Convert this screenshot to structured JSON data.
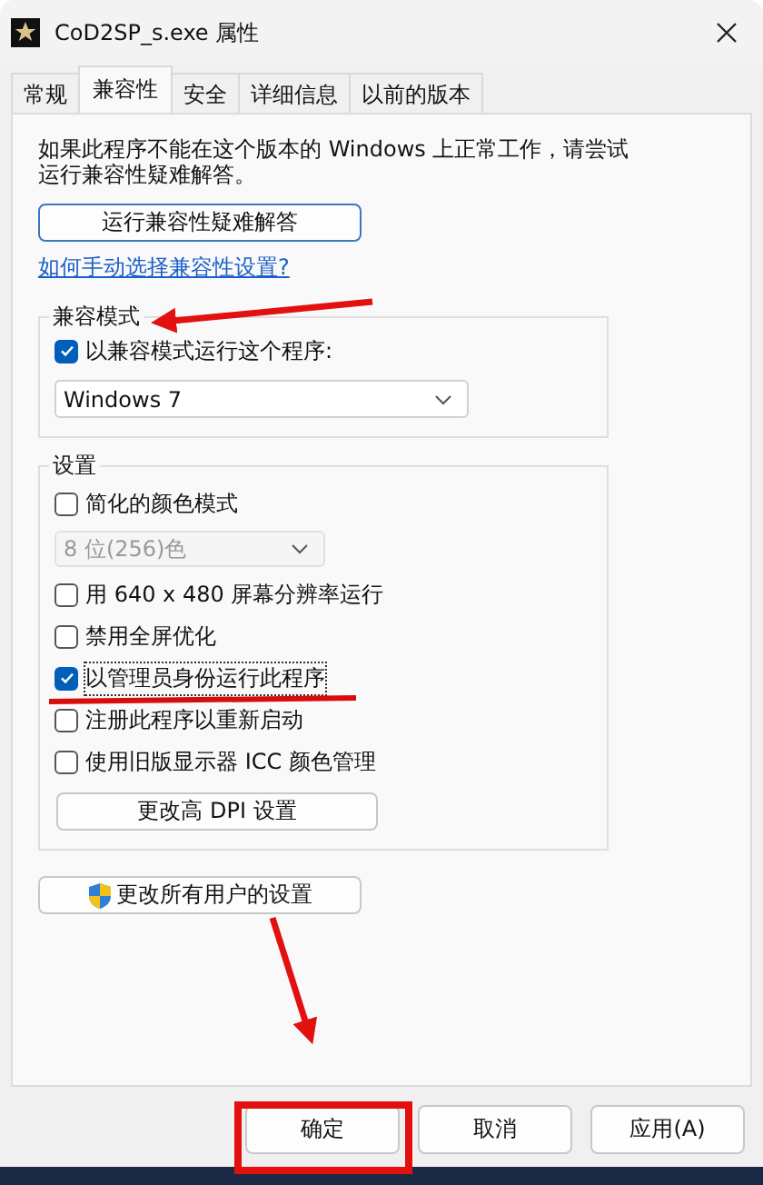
{
  "window": {
    "title": "CoD2SP_s.exe 属性"
  },
  "tabs": [
    {
      "label": "常规",
      "selected": false
    },
    {
      "label": "兼容性",
      "selected": true
    },
    {
      "label": "安全",
      "selected": false
    },
    {
      "label": "详细信息",
      "selected": false
    },
    {
      "label": "以前的版本",
      "selected": false
    }
  ],
  "intro": "如果此程序不能在这个版本的 Windows 上正常工作，请尝试运行兼容性疑难解答。",
  "troubleshoot_button": "运行兼容性疑难解答",
  "help_link": "如何手动选择兼容性设置?",
  "compat_mode": {
    "title": "兼容模式",
    "checkbox": {
      "label": "以兼容模式运行这个程序:",
      "checked": true
    },
    "select": {
      "value": "Windows 7",
      "disabled": false
    }
  },
  "settings": {
    "title": "设置",
    "items": [
      {
        "kind": "checkbox",
        "label": "简化的颜色模式",
        "checked": false
      },
      {
        "kind": "select",
        "value": "8 位(256)色",
        "disabled": true
      },
      {
        "kind": "checkbox",
        "label": "用 640 x 480 屏幕分辨率运行",
        "checked": false
      },
      {
        "kind": "checkbox",
        "label": "禁用全屏优化",
        "checked": false
      },
      {
        "kind": "checkbox",
        "label": "以管理员身份运行此程序",
        "checked": true
      },
      {
        "kind": "checkbox",
        "label": "注册此程序以重新启动",
        "checked": false
      },
      {
        "kind": "checkbox",
        "label": "使用旧版显示器 ICC 颜色管理",
        "checked": false
      },
      {
        "kind": "button",
        "label": "更改高 DPI 设置"
      }
    ]
  },
  "all_users_button": "更改所有用户的设置",
  "buttons": [
    "确定",
    "取消",
    "应用(A)"
  ]
}
